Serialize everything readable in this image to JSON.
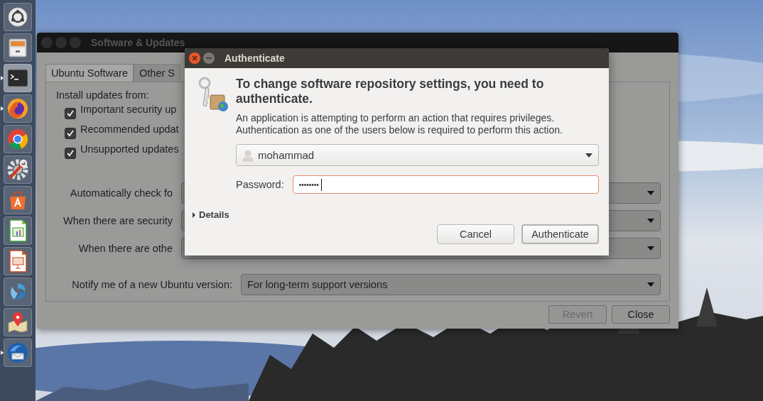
{
  "launcher": {
    "items": [
      {
        "running": false,
        "focused": false
      },
      {
        "running": false,
        "focused": false
      },
      {
        "running": true,
        "focused": true
      },
      {
        "running": true,
        "focused": false
      },
      {
        "running": false,
        "focused": false
      },
      {
        "running": false,
        "focused": false
      },
      {
        "running": false,
        "focused": false
      },
      {
        "running": false,
        "focused": false
      },
      {
        "running": false,
        "focused": false
      },
      {
        "running": false,
        "focused": false
      },
      {
        "running": false,
        "focused": false
      },
      {
        "running": true,
        "focused": false
      }
    ]
  },
  "background_window": {
    "title": "Software & Updates",
    "tabs": [
      {
        "label": "Ubuntu Software",
        "selected": true
      },
      {
        "label": "Other S",
        "selected": false
      }
    ],
    "install_label": "Install updates from:",
    "checkboxes": [
      {
        "label": "Important security up",
        "checked": true
      },
      {
        "label": "Recommended updat",
        "checked": true
      },
      {
        "label": "Unsupported updates",
        "checked": true
      }
    ],
    "settings": [
      {
        "label": "Automatically check fo"
      },
      {
        "label": "When there are security"
      },
      {
        "label": "When there are othe"
      }
    ],
    "notify": {
      "label": "Notify me of a new Ubuntu version:",
      "value": "For long-term support versions"
    },
    "buttons": [
      {
        "label": "Revert",
        "disabled": true
      },
      {
        "label": "Close",
        "disabled": false
      }
    ]
  },
  "dialog": {
    "title": "Authenticate",
    "heading": "To change software repository settings, you need to authenticate.",
    "message_lines": [
      "An application is attempting to perform an action that requires privileges.",
      "Authentication as one of the users below is required to perform this action."
    ],
    "user": "mohammad",
    "password_label": "Password:",
    "password": "••••••••",
    "password_focused": true,
    "details": {
      "label": "Details",
      "expanded": false
    },
    "buttons": [
      {
        "label": "Cancel",
        "default": false
      },
      {
        "label": "Authenticate",
        "default": true
      }
    ]
  }
}
